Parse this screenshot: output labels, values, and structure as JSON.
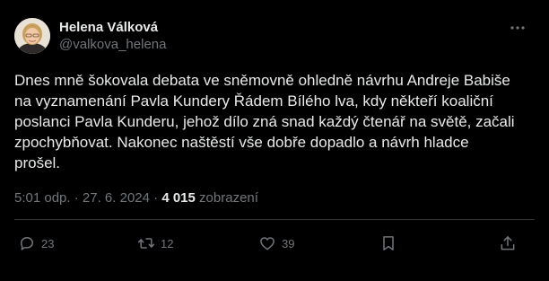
{
  "author": {
    "name": "Helena Válková",
    "handle": "@valkova_helena"
  },
  "post": {
    "lines": [
      "Dnes mně šokovala debata ve sněmovně ohledně návrhu Andreje Babiše",
      "na vyznamenání Pavla Kundery Řádem Bílého lva, kdy někteří koaliční",
      "poslanci Pavla Kunderu, jehož dílo zná snad každý čtenář na světě, začali",
      "zpochybňovat. Nakonec naštěstí vše dobře dopadlo a návrh hladce",
      "prošel."
    ]
  },
  "meta": {
    "time": "5:01 odp.",
    "separator": " · ",
    "date": "27. 6. 2024",
    "views": "4 015",
    "views_label": "zobrazení"
  },
  "actions": {
    "replies": "23",
    "reposts": "12",
    "likes": "39"
  },
  "icons": {
    "more": "more-horizontal-icon",
    "reply": "speech-bubble-icon",
    "repost": "repost-arrows-icon",
    "like": "heart-icon",
    "bookmark": "bookmark-icon",
    "share": "share-upload-icon"
  },
  "colors": {
    "background": "#000000",
    "text": "#e7e9ea",
    "muted": "#71767b",
    "divider": "#2f3336"
  }
}
